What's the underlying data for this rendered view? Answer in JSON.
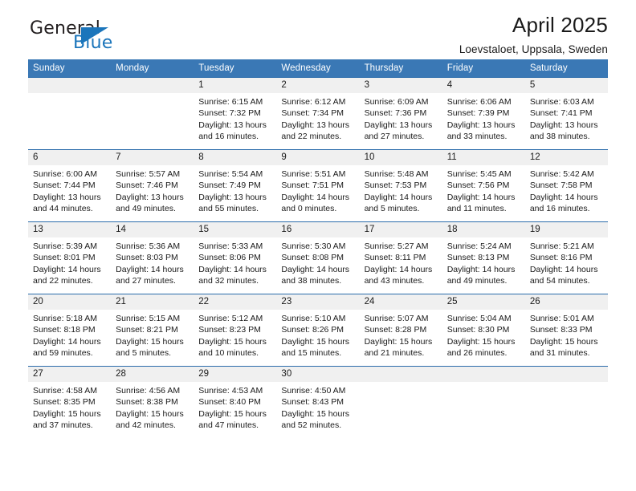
{
  "brand": {
    "name_part1": "General",
    "name_part2": "Blue",
    "triangle_color": "#1b75bb"
  },
  "header": {
    "title": "April 2025",
    "subtitle": "Loevstaloet, Uppsala, Sweden"
  },
  "theme": {
    "header_row_bg": "#3a78b5",
    "row_separator": "#2b6cab",
    "daynum_bg": "#f0f0f0"
  },
  "weekday_headers": [
    "Sunday",
    "Monday",
    "Tuesday",
    "Wednesday",
    "Thursday",
    "Friday",
    "Saturday"
  ],
  "weeks": [
    [
      {
        "day": "",
        "sunrise": "",
        "sunset": "",
        "daylight": ""
      },
      {
        "day": "",
        "sunrise": "",
        "sunset": "",
        "daylight": ""
      },
      {
        "day": "1",
        "sunrise": "Sunrise: 6:15 AM",
        "sunset": "Sunset: 7:32 PM",
        "daylight": "Daylight: 13 hours and 16 minutes."
      },
      {
        "day": "2",
        "sunrise": "Sunrise: 6:12 AM",
        "sunset": "Sunset: 7:34 PM",
        "daylight": "Daylight: 13 hours and 22 minutes."
      },
      {
        "day": "3",
        "sunrise": "Sunrise: 6:09 AM",
        "sunset": "Sunset: 7:36 PM",
        "daylight": "Daylight: 13 hours and 27 minutes."
      },
      {
        "day": "4",
        "sunrise": "Sunrise: 6:06 AM",
        "sunset": "Sunset: 7:39 PM",
        "daylight": "Daylight: 13 hours and 33 minutes."
      },
      {
        "day": "5",
        "sunrise": "Sunrise: 6:03 AM",
        "sunset": "Sunset: 7:41 PM",
        "daylight": "Daylight: 13 hours and 38 minutes."
      }
    ],
    [
      {
        "day": "6",
        "sunrise": "Sunrise: 6:00 AM",
        "sunset": "Sunset: 7:44 PM",
        "daylight": "Daylight: 13 hours and 44 minutes."
      },
      {
        "day": "7",
        "sunrise": "Sunrise: 5:57 AM",
        "sunset": "Sunset: 7:46 PM",
        "daylight": "Daylight: 13 hours and 49 minutes."
      },
      {
        "day": "8",
        "sunrise": "Sunrise: 5:54 AM",
        "sunset": "Sunset: 7:49 PM",
        "daylight": "Daylight: 13 hours and 55 minutes."
      },
      {
        "day": "9",
        "sunrise": "Sunrise: 5:51 AM",
        "sunset": "Sunset: 7:51 PM",
        "daylight": "Daylight: 14 hours and 0 minutes."
      },
      {
        "day": "10",
        "sunrise": "Sunrise: 5:48 AM",
        "sunset": "Sunset: 7:53 PM",
        "daylight": "Daylight: 14 hours and 5 minutes."
      },
      {
        "day": "11",
        "sunrise": "Sunrise: 5:45 AM",
        "sunset": "Sunset: 7:56 PM",
        "daylight": "Daylight: 14 hours and 11 minutes."
      },
      {
        "day": "12",
        "sunrise": "Sunrise: 5:42 AM",
        "sunset": "Sunset: 7:58 PM",
        "daylight": "Daylight: 14 hours and 16 minutes."
      }
    ],
    [
      {
        "day": "13",
        "sunrise": "Sunrise: 5:39 AM",
        "sunset": "Sunset: 8:01 PM",
        "daylight": "Daylight: 14 hours and 22 minutes."
      },
      {
        "day": "14",
        "sunrise": "Sunrise: 5:36 AM",
        "sunset": "Sunset: 8:03 PM",
        "daylight": "Daylight: 14 hours and 27 minutes."
      },
      {
        "day": "15",
        "sunrise": "Sunrise: 5:33 AM",
        "sunset": "Sunset: 8:06 PM",
        "daylight": "Daylight: 14 hours and 32 minutes."
      },
      {
        "day": "16",
        "sunrise": "Sunrise: 5:30 AM",
        "sunset": "Sunset: 8:08 PM",
        "daylight": "Daylight: 14 hours and 38 minutes."
      },
      {
        "day": "17",
        "sunrise": "Sunrise: 5:27 AM",
        "sunset": "Sunset: 8:11 PM",
        "daylight": "Daylight: 14 hours and 43 minutes."
      },
      {
        "day": "18",
        "sunrise": "Sunrise: 5:24 AM",
        "sunset": "Sunset: 8:13 PM",
        "daylight": "Daylight: 14 hours and 49 minutes."
      },
      {
        "day": "19",
        "sunrise": "Sunrise: 5:21 AM",
        "sunset": "Sunset: 8:16 PM",
        "daylight": "Daylight: 14 hours and 54 minutes."
      }
    ],
    [
      {
        "day": "20",
        "sunrise": "Sunrise: 5:18 AM",
        "sunset": "Sunset: 8:18 PM",
        "daylight": "Daylight: 14 hours and 59 minutes."
      },
      {
        "day": "21",
        "sunrise": "Sunrise: 5:15 AM",
        "sunset": "Sunset: 8:21 PM",
        "daylight": "Daylight: 15 hours and 5 minutes."
      },
      {
        "day": "22",
        "sunrise": "Sunrise: 5:12 AM",
        "sunset": "Sunset: 8:23 PM",
        "daylight": "Daylight: 15 hours and 10 minutes."
      },
      {
        "day": "23",
        "sunrise": "Sunrise: 5:10 AM",
        "sunset": "Sunset: 8:26 PM",
        "daylight": "Daylight: 15 hours and 15 minutes."
      },
      {
        "day": "24",
        "sunrise": "Sunrise: 5:07 AM",
        "sunset": "Sunset: 8:28 PM",
        "daylight": "Daylight: 15 hours and 21 minutes."
      },
      {
        "day": "25",
        "sunrise": "Sunrise: 5:04 AM",
        "sunset": "Sunset: 8:30 PM",
        "daylight": "Daylight: 15 hours and 26 minutes."
      },
      {
        "day": "26",
        "sunrise": "Sunrise: 5:01 AM",
        "sunset": "Sunset: 8:33 PM",
        "daylight": "Daylight: 15 hours and 31 minutes."
      }
    ],
    [
      {
        "day": "27",
        "sunrise": "Sunrise: 4:58 AM",
        "sunset": "Sunset: 8:35 PM",
        "daylight": "Daylight: 15 hours and 37 minutes."
      },
      {
        "day": "28",
        "sunrise": "Sunrise: 4:56 AM",
        "sunset": "Sunset: 8:38 PM",
        "daylight": "Daylight: 15 hours and 42 minutes."
      },
      {
        "day": "29",
        "sunrise": "Sunrise: 4:53 AM",
        "sunset": "Sunset: 8:40 PM",
        "daylight": "Daylight: 15 hours and 47 minutes."
      },
      {
        "day": "30",
        "sunrise": "Sunrise: 4:50 AM",
        "sunset": "Sunset: 8:43 PM",
        "daylight": "Daylight: 15 hours and 52 minutes."
      },
      {
        "day": "",
        "sunrise": "",
        "sunset": "",
        "daylight": ""
      },
      {
        "day": "",
        "sunrise": "",
        "sunset": "",
        "daylight": ""
      },
      {
        "day": "",
        "sunrise": "",
        "sunset": "",
        "daylight": ""
      }
    ]
  ]
}
